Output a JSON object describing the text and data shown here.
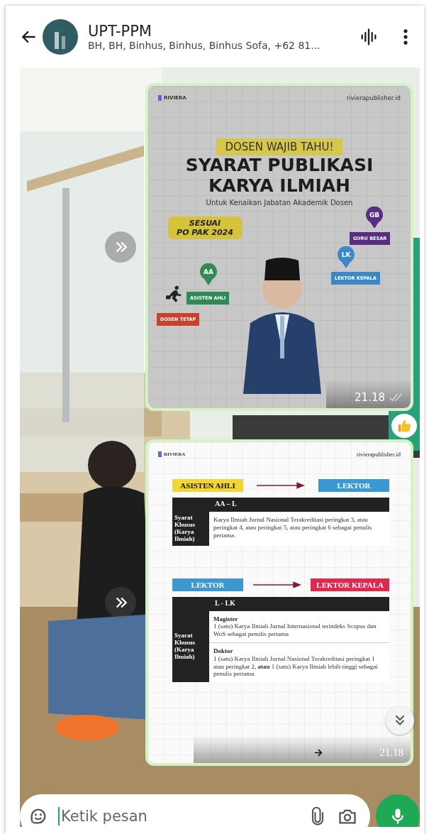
{
  "header": {
    "title": "UPT-PPM",
    "subtitle": "BH, BH, Binhus, Binhus, Binhus Sofa, +62 81..."
  },
  "messages": [
    {
      "kind": "poster",
      "brand": "RIVIERA",
      "handle": "rivierapublisher.id",
      "tag": "DOSEN WAJIB TAHU!",
      "title_lines": [
        "SYARAT PUBLIKASI",
        "KARYA ILMIAH"
      ],
      "subtitle": "Untuk Kenaikan Jabatan Akademik Dosen",
      "badge_lines": [
        "SESUAI",
        "PO PAK 2024"
      ],
      "start_label": "DOSEN TETAP",
      "steps": [
        {
          "code": "GB",
          "label": "GURU BESAR",
          "color": "#5a2d82"
        },
        {
          "code": "LK",
          "label": "LEKTOR KEPALA",
          "color": "#3b88c9"
        },
        {
          "code": "AA",
          "label": "ASISTEN AHLI",
          "color": "#2f8a55"
        }
      ],
      "time": "21.18",
      "read": true,
      "reacted": true
    },
    {
      "kind": "document",
      "brand": "RIVIERA",
      "handle": "rivierapublisher.id",
      "sections": [
        {
          "from": {
            "label": "ASISTEN AHLI",
            "color": "#f2d633"
          },
          "to": {
            "label": "LEKTOR",
            "color": "#3b98d2"
          },
          "code": "AA – L",
          "row_head": "Syarat Khusus (Karya Ilmiah)",
          "entries": [
            {
              "text": "Karya Ilmiah Jurnal Nasional Terakreditasi peringkat 3, atau peringkat 4, atau peringkat 5, atau peringkat 6 sebagai penulis pertama."
            }
          ]
        },
        {
          "from": {
            "label": "LEKTOR",
            "color": "#3b98d2"
          },
          "to": {
            "label": "LEKTOR KEPALA",
            "color": "#e0294f"
          },
          "code": "L - LK",
          "row_head": "Syarat Khusus (Karya Ilmiah)",
          "entries": [
            {
              "heading": "Magister",
              "text": "1 (satu) Karya Ilmiah Jurnal Internasional terindeks Scopus dan WoS sebagai penulis pertama"
            },
            {
              "heading": "Doktor",
              "text": "1 (satu) Karya Ilmiah Jurnal Nasional Terakreditasi peringkat 1 atau peringkat 2, **atau** 1 (satu) Karya Ilmiah lebih tinggi sebagai penulis pertama."
            }
          ]
        }
      ],
      "time": "21.18"
    }
  ],
  "composer": {
    "placeholder": "Ketik pesan"
  }
}
